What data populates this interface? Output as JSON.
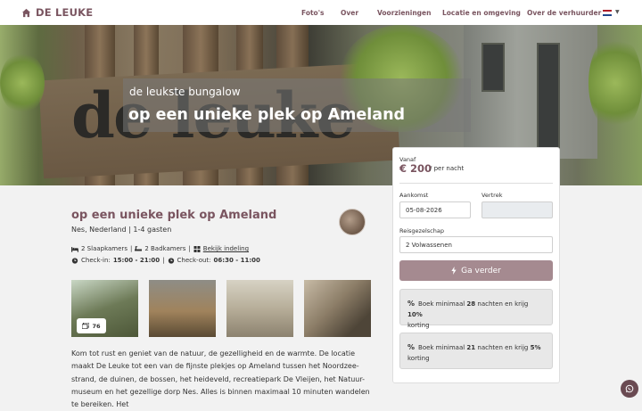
{
  "nav": {
    "brand": "DE LEUKE",
    "links": [
      "Foto's",
      "Over",
      "Voorzieningen",
      "Locatie en omgeving",
      "Over de verhuurder"
    ],
    "language_flag": "nl-flag"
  },
  "hero": {
    "line1": "de leukste bungalow",
    "line2": "op een unieke plek op Ameland",
    "sign_text": "de leuke"
  },
  "listing": {
    "title": "op een unieke plek op Ameland",
    "subtitle": "Nes, Nederland | 1-4 gasten",
    "bedrooms": "2 Slaapkamers",
    "bathrooms": "2 Badkamers",
    "layout_link": "Bekijk indeling",
    "checkin_label": "Check-in:",
    "checkin_time": "15:00 - 21:00",
    "checkout_label": "Check-out:",
    "checkout_time": "06:30 - 11:00",
    "photo_count": "76",
    "description": "Kom tot rust en geniet van de natuur, de gezelligheid en de warmte. De locatie maakt De Leuke tot een van de fijnste plekjes op Ameland tussen het Noordzee-strand, de duinen, de bossen, het heideveld, recreatiepark De Vleijen, het Natuur-museum en het gezellige dorp Nes. Alles is binnen maximaal 10 minuten wandelen te bereiken. Het"
  },
  "booking": {
    "from_label": "Vanaf",
    "price": "€ 200",
    "per_night": "/ per nacht",
    "arrival_label": "Aankomst",
    "arrival_value": "05-08-2026",
    "departure_label": "Vertrek",
    "departure_value": "",
    "party_label": "Reisgezelschap",
    "party_value": "2 Volwassenen",
    "go_button": "Ga verder",
    "promos": [
      {
        "pre": "Boek minimaal ",
        "nights": "28",
        "mid": " nachten en krijg ",
        "pct": "10%",
        "post": "korting"
      },
      {
        "pre": "Boek minimaal ",
        "nights": "21",
        "mid": " nachten en krijg ",
        "pct": "5%",
        "post": "korting"
      }
    ]
  },
  "colors": {
    "brand": "#7a5560",
    "button": "#a58a90",
    "whatsapp_bg": "#6a4a52"
  }
}
